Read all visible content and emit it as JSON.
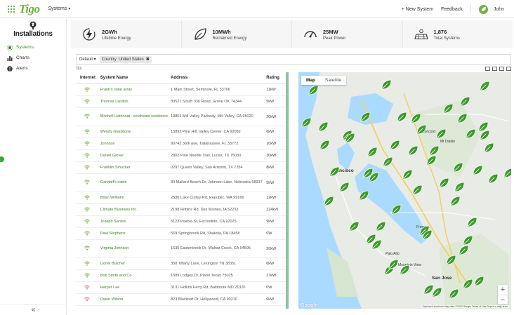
{
  "app": {
    "logo": "Tigo",
    "nav_dropdown": "Systems",
    "new_system": "+ New System",
    "feedback": "Feedback",
    "user": "John"
  },
  "sidebar": {
    "title": "Installations",
    "items": [
      {
        "label": "Systems",
        "active": true,
        "icon": "sun-icon"
      },
      {
        "label": "Charts",
        "active": false,
        "icon": "bar-chart-icon"
      },
      {
        "label": "Alerts",
        "active": false,
        "icon": "alert-icon"
      }
    ],
    "collapse": "«"
  },
  "stats": [
    {
      "value": "2GWh",
      "label": "Lifetime Energy",
      "icon": "lightning-icon"
    },
    {
      "value": "10MWh",
      "label": "Reclaimed Energy",
      "icon": "leaf-icon"
    },
    {
      "value": "25MW",
      "label": "Peak Power",
      "icon": "gauge-icon"
    },
    {
      "value": "1,876",
      "label": "Total Systems",
      "icon": "solar-panel-icon"
    }
  ],
  "filter": {
    "preset": "Default",
    "chip_field": "Country",
    "chip_value": "United States"
  },
  "table": {
    "columns": [
      "Internet",
      "System Name",
      "Address",
      "Rating"
    ],
    "rows": [
      {
        "name": "Frank's solar array",
        "address": "1 Main Street, Seminole, FL 33706",
        "rating": "11kW",
        "online": true
      },
      {
        "name": "Thomas Landon",
        "address": "89521 South 336 Road, Grove OK 74344",
        "rating": "5kW",
        "online": true
      },
      {
        "name": "Mitchell Hethcoat - southeast residence",
        "address": "19853 Mill Valley Parkway, Mill Valley, CA 95020",
        "rating": "20kW",
        "online": true
      },
      {
        "name": "Wendy Gladstone",
        "address": "15892 Pine Hill, Valley Center, CA 92082",
        "rating": "6kW",
        "online": true
      },
      {
        "name": "Johnson",
        "address": "90742 36th ave, Tallahassee, FL 33772",
        "rating": "10kW",
        "online": true
      },
      {
        "name": "Daniel Glover",
        "address": "2802 Pine Needle Trail, Lucas, TX 75030",
        "rating": "30kW",
        "online": true
      },
      {
        "name": "Franklin Smucker",
        "address": "0297 Queen Valley, San Antonio, TX 7254",
        "rating": "8kW",
        "online": true
      },
      {
        "name": "Gandalf's cabin",
        "address": "89 Mallard Beach Dr, Johnson Lake, Nebraska 68937",
        "rating": "5kW",
        "online": true
      },
      {
        "name": "Brian Wilhelm",
        "address": "2536 Lake Curley Rd, Republic, WA 99166",
        "rating": "12kW",
        "online": true
      },
      {
        "name": "Climate Business Inc.",
        "address": "2198 Robins Rd, Des Moines, IA 52233",
        "rating": "224kW",
        "online": true
      },
      {
        "name": "Joseph Santos",
        "address": "5123 Puebla St, Escondido, CA 92025",
        "rating": "9kW",
        "online": true
      },
      {
        "name": "Paul Stephens",
        "address": "569 Springbrook Rd, Shakola, PA 18458",
        "rating": "0W",
        "online": true
      },
      {
        "name": "Virginia Johnson",
        "address": "1635 Easterbrook Dr. Walnut Creek, CA 94595",
        "rating": "20kW",
        "online": true
      },
      {
        "name": "Lionel Butcher",
        "address": "358 Tiffany Lane, Lexington TN 38351",
        "rating": "6kW",
        "online": true
      },
      {
        "name": "Bob Smith and Co",
        "address": "1589 Lodgey Dr, Plano Texas 75025",
        "rating": "27kW",
        "online": true
      },
      {
        "name": "Harper Lee",
        "address": "3131 Hollins Ferry Rd, Baltimore MD 21320",
        "rating": "0W",
        "online": false
      },
      {
        "name": "Owen Wilson",
        "address": "823 Blackturf Dr. Hollywood, CA 90210",
        "rating": "6kW",
        "online": false
      }
    ]
  },
  "map": {
    "tabs": [
      "Map",
      "Satellite"
    ],
    "active_tab": "Map",
    "zoom_in": "+",
    "zoom_out": "−",
    "google": "Google",
    "attribution": "Keyboard shortcuts   Map data ©2023 Google   Terms of Use   Report a map error",
    "places": [
      {
        "label": "Francisco",
        "city": true
      },
      {
        "label": "San Jose",
        "city": true
      },
      {
        "label": "Fremont",
        "city": false
      },
      {
        "label": "Concord",
        "city": false
      },
      {
        "label": "Mt Diablo",
        "city": false
      },
      {
        "label": "Palo Alto",
        "city": false
      },
      {
        "label": "Mountain View",
        "city": false
      }
    ]
  },
  "colors": {
    "brand": "#6cb33f",
    "link": "#3e7f2a",
    "offline": "#e57373",
    "scroll": "#8fc2a0"
  }
}
